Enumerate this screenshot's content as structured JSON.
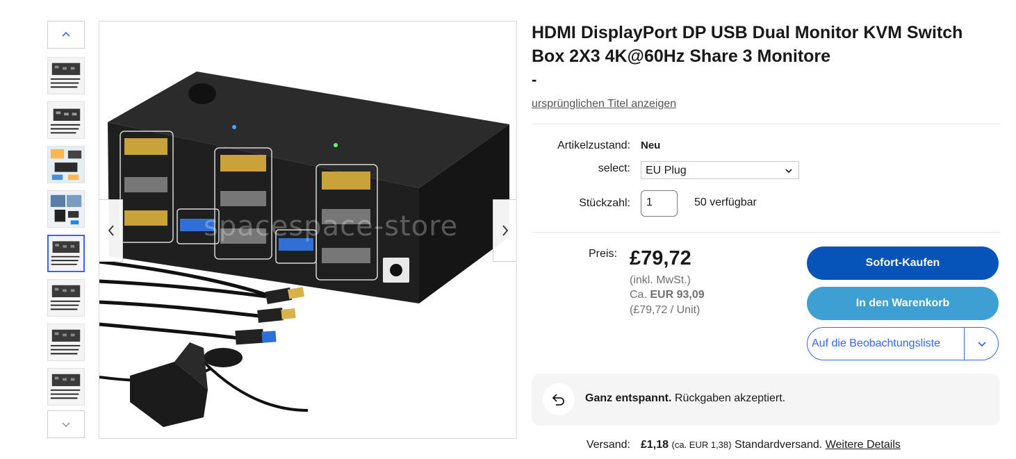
{
  "product": {
    "title": "HDMI DisplayPort DP USB Dual Monitor KVM Switch Box 2X3 4K@60Hz Share 3 Monitore",
    "subtitle": "-",
    "show_original_link": "ursprünglichen Titel anzeigen",
    "watermark": "spacespace-store"
  },
  "details": {
    "condition_label": "Artikelzustand:",
    "condition_value": "Neu",
    "select_label": "select:",
    "select_value": "EU Plug",
    "quantity_label": "Stückzahl:",
    "quantity_value": "1",
    "available": "50 verfügbar"
  },
  "pricing": {
    "price_label": "Preis:",
    "price": "£79,72",
    "vat_note": "(inkl. MwSt.)",
    "approx_prefix": "Ca.",
    "approx_value": "EUR 93,09",
    "unit_price": "(£79,72 / Unit)"
  },
  "actions": {
    "buy_now": "Sofort-Kaufen",
    "add_to_cart": "In den Warenkorb",
    "watchlist": "Auf die Beobachtungsliste"
  },
  "returns": {
    "bold": "Ganz entspannt.",
    "text": " Rückgaben akzeptiert."
  },
  "shipping": {
    "label": "Versand:",
    "price": "£1,18",
    "approx": "(ca. EUR 1,38)",
    "method": "Standardversand.",
    "details_link": "Weitere Details"
  },
  "icons": {
    "thumb_up": "chevron-up-icon",
    "thumb_down": "chevron-down-icon",
    "prev": "chevron-left-icon",
    "next": "chevron-right-icon",
    "returns": "return-arrow-icon"
  },
  "colors": {
    "buy_button": "#0654ba",
    "cart_button": "#3e9fd3",
    "link_blue": "#3665f3",
    "returns_bg": "#f5f5f5"
  }
}
